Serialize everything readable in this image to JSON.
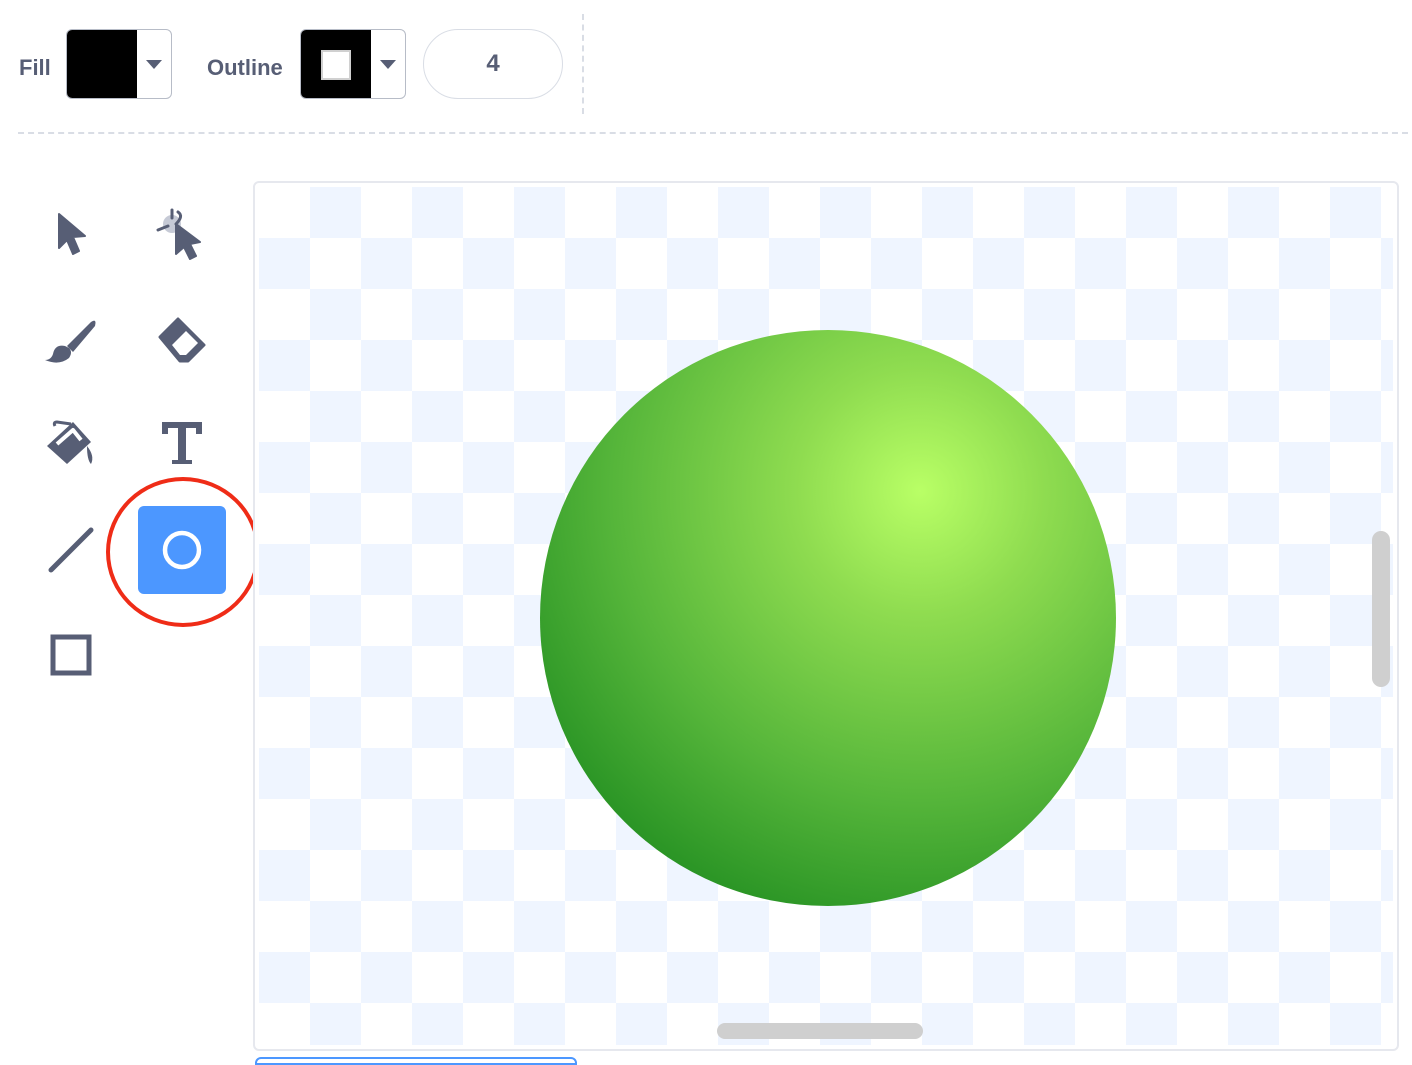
{
  "toolbar": {
    "fill_label": "Fill",
    "fill_color": "#000000",
    "outline_label": "Outline",
    "outline_color": "#000000",
    "outline_width": "4"
  },
  "tools": [
    {
      "name": "select",
      "icon": "arrow-pointer-icon",
      "active": false
    },
    {
      "name": "reshape",
      "icon": "reshape-pointer-icon",
      "active": false
    },
    {
      "name": "brush",
      "icon": "paintbrush-icon",
      "active": false
    },
    {
      "name": "eraser",
      "icon": "eraser-icon",
      "active": false
    },
    {
      "name": "fill",
      "icon": "paint-bucket-icon",
      "active": false
    },
    {
      "name": "text",
      "icon": "text-t-icon",
      "active": false
    },
    {
      "name": "line",
      "icon": "line-icon",
      "active": false
    },
    {
      "name": "circle",
      "icon": "circle-icon",
      "active": true
    },
    {
      "name": "rectangle",
      "icon": "rectangle-icon",
      "active": false
    }
  ],
  "colors": {
    "accent": "#4c97ff",
    "highlight": "#ef2c17",
    "icon": "#575e75",
    "ball_light": "#b9ff66",
    "ball_dark": "#11791c"
  }
}
